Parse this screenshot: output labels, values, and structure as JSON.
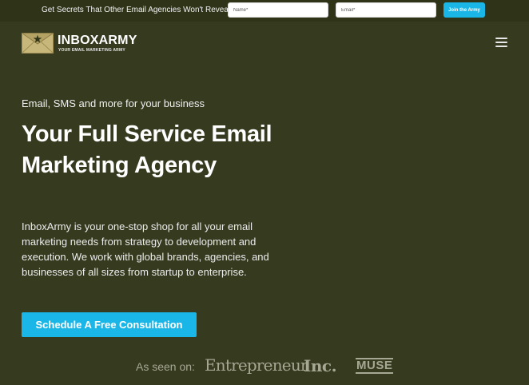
{
  "promo_bar": {
    "text": "Get Secrets That Other Email Agencies Won't Reveal",
    "name_placeholder": "Name*",
    "email_placeholder": "Email*",
    "join_label": "Join the Army"
  },
  "header": {
    "logo_name": "INBOXARMY",
    "logo_tagline": "YOUR EMAIL MARKETING ARMY",
    "menu_icon": "hamburger-menu-icon"
  },
  "hero": {
    "eyebrow": "Email, SMS and more for your business",
    "headline": "Your Full Service Email Marketing Agency",
    "description": "InboxArmy is your one-stop shop for all your email marketing needs from strategy to development and execution. We work with global brands, agencies, and businesses of all sizes from startup to enterprise.",
    "cta_label": "Schedule A Free Consultation"
  },
  "as_seen_on": {
    "label": "As seen on:",
    "logos": [
      "Entrepreneur",
      "Inc.",
      "MUSE"
    ]
  },
  "colors": {
    "background": "#363a1f",
    "top_bar": "#2f3318",
    "accent": "#1bb6e8",
    "logo_envelope": "#c8b77a",
    "press_logos": "#a7a894"
  }
}
